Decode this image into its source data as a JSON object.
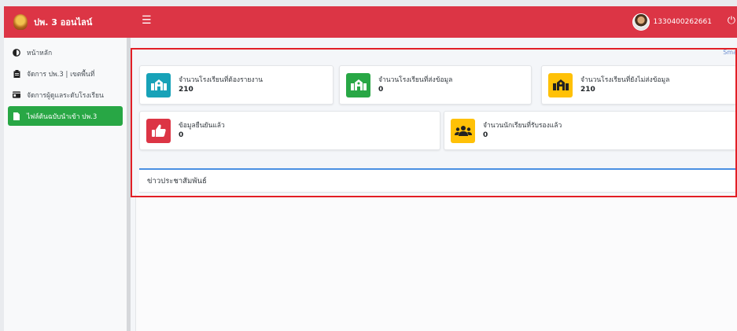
{
  "brand": {
    "title": "ปพ. 3 ออนไลน์"
  },
  "topbar": {
    "user_id": "1330400262661"
  },
  "sidebar": {
    "items": [
      {
        "label": "หน้าหลัก",
        "icon": "half-circle-icon"
      },
      {
        "label": "จัดการ ปพ.3 | เขตพื้นที่",
        "icon": "clipboard-icon"
      },
      {
        "label": "จัดการผู้ดูแลระดับโรงเรียน",
        "icon": "id-card-icon"
      },
      {
        "label": "ไฟล์ต้นฉบับนำเข้า ปพ.3",
        "icon": "file-icon"
      }
    ]
  },
  "corner_text": "Sma",
  "stats": [
    {
      "label": "จำนวนโรงเรียนที่ต้องรายงาน",
      "value": "210",
      "color": "#17a2b8",
      "icon": "school-icon"
    },
    {
      "label": "จำนวนโรงเรียนที่ส่งข้อมูล",
      "value": "0",
      "color": "#28a745",
      "icon": "school-icon"
    },
    {
      "label": "จำนวนโรงเรียนที่ยังไม่ส่งข้อมูล",
      "value": "210",
      "color": "#ffc107",
      "icon": "school-icon"
    },
    {
      "label": "ข้อมูลยืนยันแล้ว",
      "value": "0",
      "color": "#dc3545",
      "icon": "thumbs-up-icon"
    },
    {
      "label": "จำนวนนักเรียนที่รับรองแล้ว",
      "value": "0",
      "color": "#ffc107",
      "icon": "users-icon"
    }
  ],
  "news": {
    "title": "ข่าวประชาสัมพันธ์"
  },
  "colors": {
    "primary": "#dc3545",
    "active": "#28a745",
    "highlight": "#e21f26"
  }
}
